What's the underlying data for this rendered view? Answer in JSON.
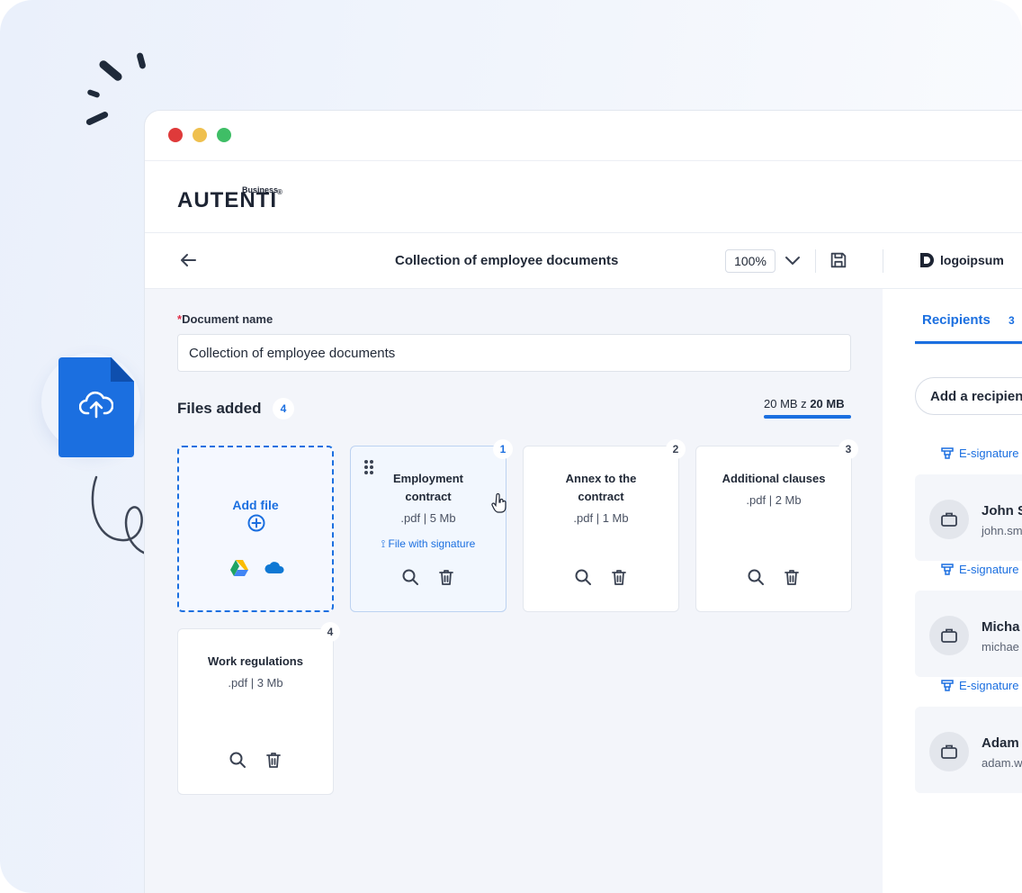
{
  "brand": {
    "small": "Business",
    "name": "AUTENTI",
    "reg": "®"
  },
  "toolbar": {
    "title": "Collection of employee documents",
    "zoom": "100%",
    "partner_logo": "logoipsum"
  },
  "form": {
    "required_mark": "*",
    "name_label": "Document name",
    "name_value": "Collection of employee documents"
  },
  "files": {
    "title": "Files added",
    "count": "4",
    "storage_used": "20 MB z",
    "storage_total": "20 MB",
    "add_label": "Add file",
    "items": [
      {
        "num": "1",
        "title": "Employment contract",
        "meta": ".pdf | 5 Mb",
        "signature": "File with signature"
      },
      {
        "num": "2",
        "title": "Annex to the contract",
        "meta": ".pdf | 1 Mb"
      },
      {
        "num": "3",
        "title": "Additional clauses",
        "meta": ".pdf | 2 Mb"
      },
      {
        "num": "4",
        "title": "Work regulations",
        "meta": ".pdf | 3 Mb"
      }
    ]
  },
  "side": {
    "tab_label": "Recipients",
    "tab_count": "3",
    "add_button": "Add a recipien",
    "recipients": [
      {
        "tag": "E-signature",
        "name": "John S",
        "email": "john.sm"
      },
      {
        "tag": "E-signature",
        "name": "Micha",
        "email": "michae"
      },
      {
        "tag": "E-signature",
        "name": "Adam",
        "email": "adam.w"
      }
    ]
  },
  "colors": {
    "accent": "#1b6fe0",
    "close": "#df3a3a",
    "minimize": "#efc04f",
    "maximize": "#3fbe66"
  }
}
